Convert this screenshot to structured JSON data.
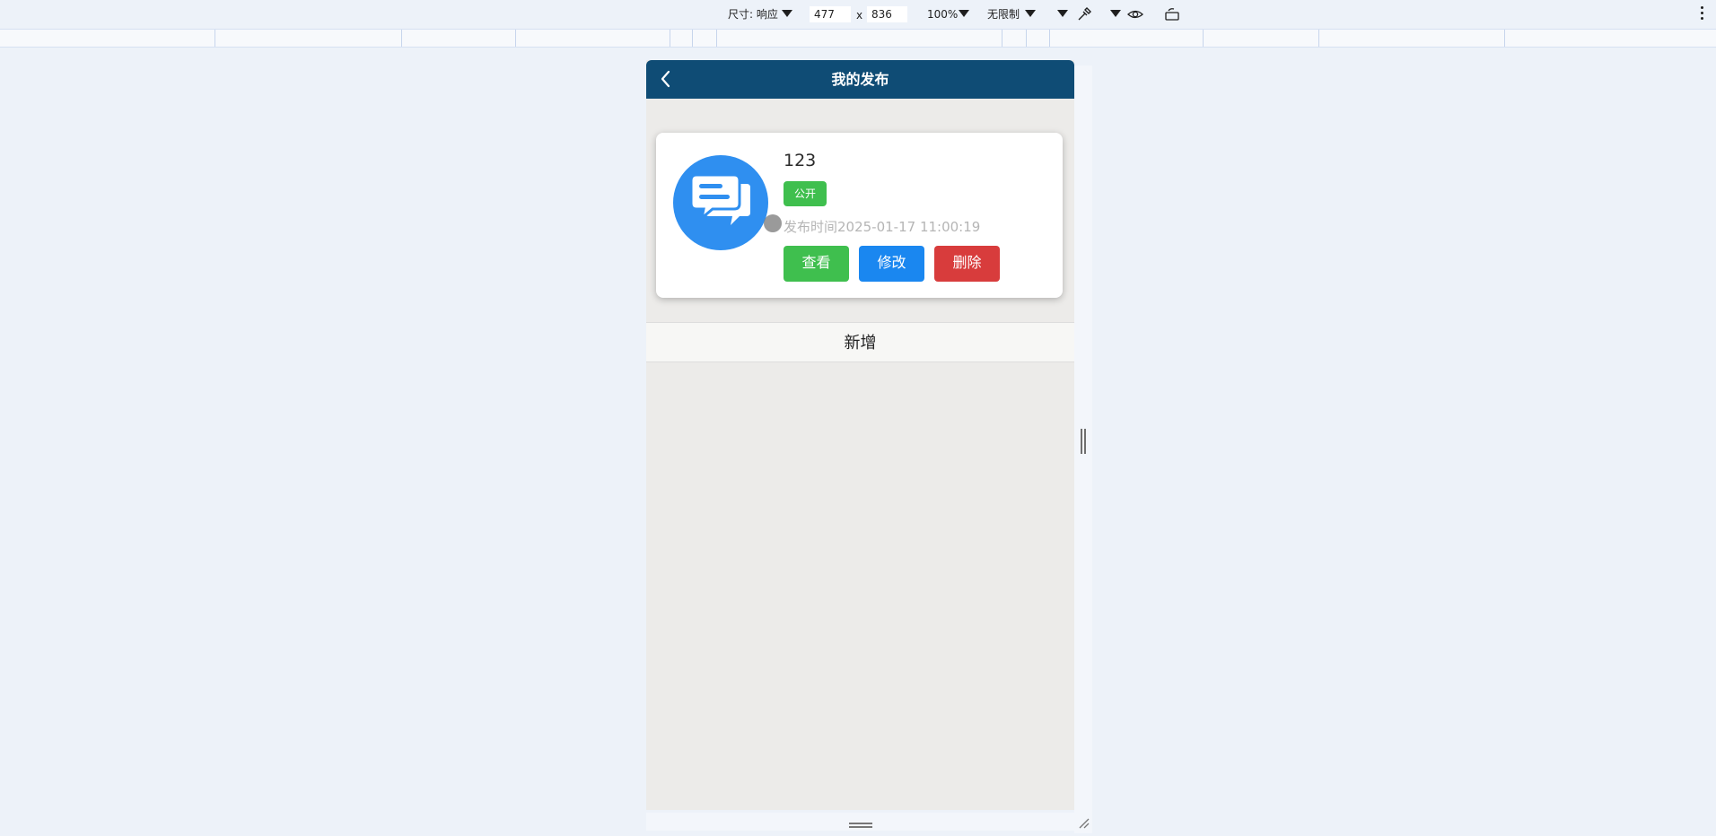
{
  "devtools": {
    "dimensions_label": "尺寸: 响应",
    "width": "477",
    "times": "x",
    "height": "836",
    "zoom": "100%",
    "throttle": "无限制"
  },
  "app": {
    "title": "我的发布",
    "colors": {
      "header": "#0f4c75",
      "view": "#3fbf4e",
      "edit": "#1a87f0",
      "delete": "#d83c3c"
    }
  },
  "card": {
    "title": "123",
    "badge": "公开",
    "publish_time": "发布时间2025-01-17 11:00:19",
    "view_label": "查看",
    "edit_label": "修改",
    "delete_label": "删除",
    "avatar_icon": "chat-bubbles-icon"
  },
  "add_label": "新增"
}
